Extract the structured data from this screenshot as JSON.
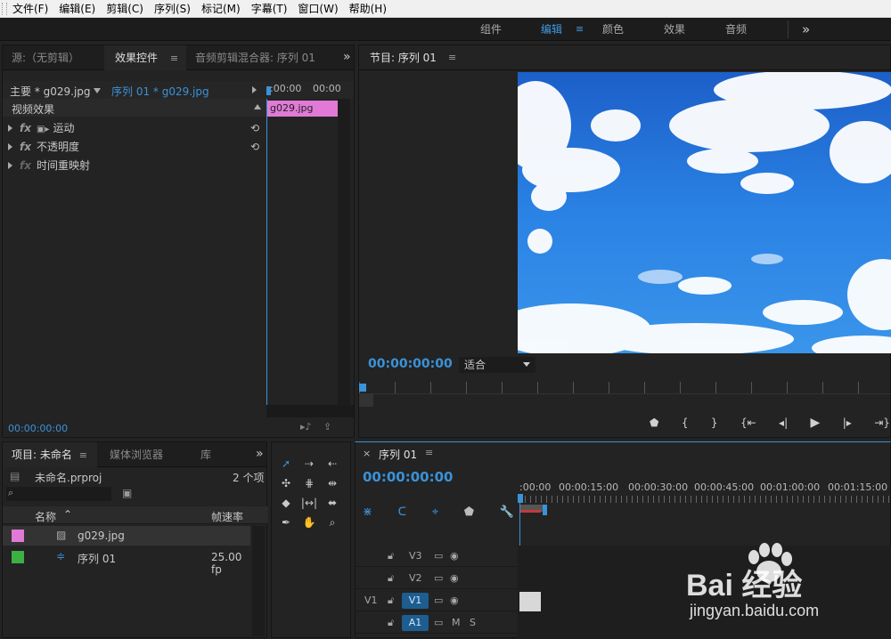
{
  "menubar": {
    "items": [
      "文件(F)",
      "编辑(E)",
      "剪辑(C)",
      "序列(S)",
      "标记(M)",
      "字幕(T)",
      "窗口(W)",
      "帮助(H)"
    ]
  },
  "workspaces": {
    "tabs": [
      "组件",
      "编辑",
      "颜色",
      "效果",
      "音频"
    ],
    "active": "编辑",
    "more": "»"
  },
  "source_panel": {
    "tabs": [
      "源:（无剪辑）",
      "效果控件",
      "音频剪辑混合器: 序列 01"
    ],
    "master_label": "主要 * g029.jpg",
    "sequence_label": "序列 01 * g029.jpg",
    "ruler_start": ":00:00",
    "ruler_end": "00:00",
    "clip_label": "g029.jpg",
    "section_label": "视频效果",
    "effects": [
      "运动",
      "不透明度",
      "时间重映射"
    ],
    "timecode": "00:00:00:00"
  },
  "program_monitor": {
    "title": "节目: 序列 01",
    "timecode": "00:00:00:00",
    "fit_label": "适合"
  },
  "project_panel": {
    "tabs": [
      "项目: 未命名",
      "媒体浏览器",
      "库"
    ],
    "project_file": "未命名.prproj",
    "item_count": "2 个项",
    "col_name": "名称",
    "col_framerate": "帧速率",
    "items": [
      {
        "name": "g029.jpg",
        "color": "#e07ad6",
        "framerate": ""
      },
      {
        "name": "序列 01",
        "color": "#3cb043",
        "framerate": "25.00 fp"
      }
    ]
  },
  "timeline": {
    "tab": "序列 01",
    "timecode": "00:00:00:00",
    "ruler_labels": [
      ":00:00",
      "00:00:15:00",
      "00:00:30:00",
      "00:00:45:00",
      "00:01:00:00",
      "00:01:15:00"
    ],
    "tracks": [
      {
        "src": "",
        "name": "V3",
        "icons": [
          "film",
          "eye"
        ]
      },
      {
        "src": "",
        "name": "V2",
        "icons": [
          "film",
          "eye"
        ]
      },
      {
        "src": "V1",
        "name": "V1",
        "icons": [
          "film",
          "eye"
        ]
      },
      {
        "src": "",
        "name": "A1",
        "icons": [
          "film",
          "M",
          "S"
        ]
      }
    ]
  },
  "watermark": {
    "text": "Bai 经验",
    "url": "jingyan.baidu.com"
  },
  "colors": {
    "accent": "#3a92d8",
    "clip_pink": "#e07ad6",
    "sky": "#1a6fd6"
  }
}
